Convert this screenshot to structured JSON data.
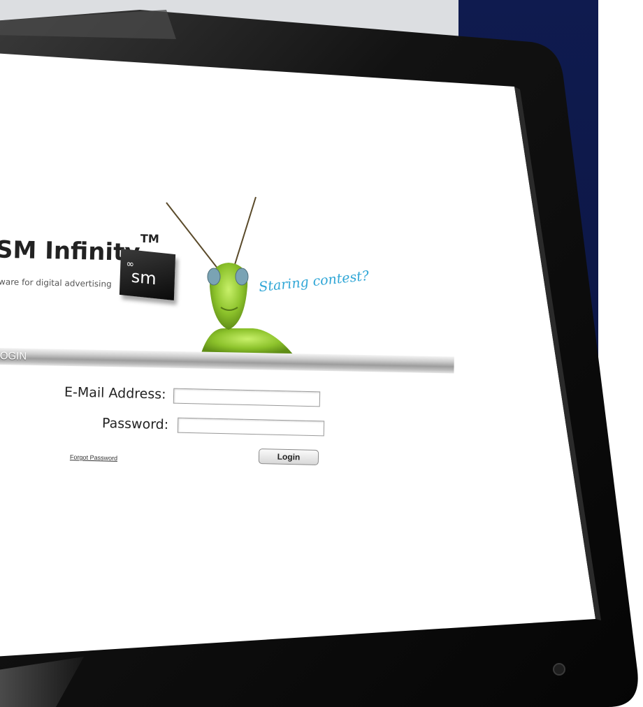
{
  "colors": {
    "bezel": "#0e0e0e",
    "screen": "#ffffff",
    "navy_panel": "#0f1b4f",
    "accent_tagline": "#2fa6d6",
    "grasshopper": "#9cd43a"
  },
  "brand": {
    "title": "SM Infinity",
    "trademark": "TM",
    "subtitle": "ware for digital advertising",
    "cube_text": "sm",
    "cube_sup": "∞"
  },
  "tagline": "Staring contest?",
  "login_header": "OGIN",
  "form": {
    "email_label": "E-Mail Address:",
    "email_value": "",
    "password_label": "Password:",
    "password_value": "",
    "forgot_label": "Forgot Password",
    "submit_label": "Login"
  }
}
